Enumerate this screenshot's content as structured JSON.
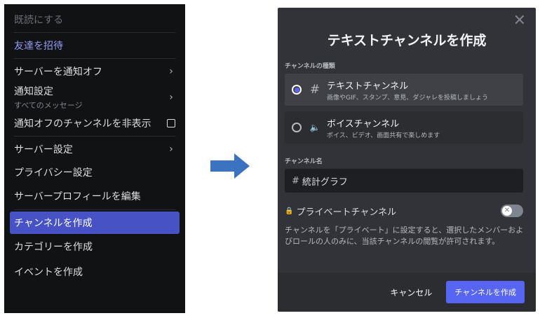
{
  "menu": {
    "mark_read": "既読にする",
    "invite": "友達を招待",
    "mute_server": "サーバーを通知オフ",
    "notification_settings": "通知設定",
    "notification_sub": "すべてのメッセージ",
    "hide_muted": "通知オフのチャンネルを非表示",
    "server_settings": "サーバー設定",
    "privacy_settings": "プライバシー設定",
    "edit_profile": "サーバープロフィールを編集",
    "create_channel": "チャンネルを作成",
    "create_category": "カテゴリーを作成",
    "create_event": "イベントを作成",
    "chevron": "›"
  },
  "colors": {
    "arrow": "#3b73c0",
    "accent": "#5865f2",
    "menu_active": "#4752c4"
  },
  "dialog": {
    "close": "✕",
    "title": "テキストチャンネルを作成",
    "type_label": "チャンネルの種類",
    "text_option": {
      "icon": "#",
      "name": "テキストチャンネル",
      "desc": "画像やGIF、スタンプ、意見、ダジャレを投稿しましょう"
    },
    "voice_option": {
      "icon": "🔈",
      "name": "ボイスチャンネル",
      "desc": "ボイス、ビデオ、画面共有で楽しめます"
    },
    "name_label": "チャンネル名",
    "name_prefix": "#",
    "name_value": "統計グラフ",
    "private_label": "プライベートチャンネル",
    "lock_icon": "🔒",
    "toggle_icon": "✕",
    "private_desc": "チャンネルを「プライベート」に設定すると、選択したメンバーおよびロールの人のみに、当該チャンネルの閲覧が許可されます。",
    "cancel": "キャンセル",
    "create": "チャンネルを作成"
  }
}
